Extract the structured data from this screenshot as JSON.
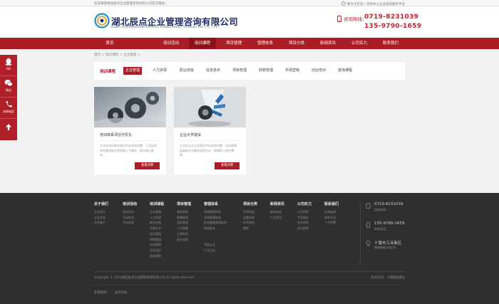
{
  "topbar": {
    "welcome": "欢迎来到湖北辰点企业管理咨询有限公司官方网站！",
    "slogan": "致力于打造一流的中小企业培训服务平台"
  },
  "header": {
    "logo_cn": "湖北辰点企业管理咨询有限公司",
    "logo_en": "HUBEI CHENDIAN ENTERPRISE MANAGEMENT CONSULTING CO., LTD",
    "hotline_label": "咨询热线：",
    "hotline_1": "0719-8231039",
    "hotline_2": "135-9790-1659"
  },
  "nav": {
    "items": [
      "首页",
      "培训活动",
      "培训课程",
      "项目管理",
      "管理体系",
      "项目分类",
      "新闻资讯",
      "公司实力",
      "联系我们"
    ],
    "active_index": 2
  },
  "breadcrumb": "首页 > 培训课程 > 企业管理 >",
  "float": {
    "items": [
      "QQ",
      "微信",
      "咨询电话"
    ]
  },
  "category": {
    "title": "培训课程",
    "items": [
      "企业管理",
      "人力资源",
      "职业技能",
      "信息技术",
      "项目管理",
      "财税管理",
      "市场营销",
      "创业培训",
      "其他课程"
    ],
    "active_index": 0
  },
  "cards": [
    {
      "title": "培训体系评估与优化",
      "desc": "企业在培训体系建设中存在的问题：公司培训体系建设缺乏规划和人才梯队，统计难以查询...",
      "button": "查看详情"
    },
    {
      "title": "企业大学建设",
      "desc": "企业在企业大学建设中存在的问题：培训管理层级缺乏必要的规划设计，前期投入相对薄弱...",
      "button": "查看详情"
    }
  ],
  "footer": {
    "columns": [
      {
        "head": "关于我们",
        "links": [
          "企业简介",
          "企业文化",
          "合作客户"
        ]
      },
      {
        "head": "培训活动",
        "links": [
          "培训活动",
          "活动报名",
          "活动回顾"
        ]
      },
      {
        "head": "培训课程",
        "links": [
          "企业管理",
          "人力资源",
          "职业技能",
          "信息技术",
          "项目管理",
          "财税管理",
          "市场营销",
          "创业培训",
          "其他课程"
        ]
      },
      {
        "head": "项目管理",
        "links": [
          "绩效管理",
          "薪酬管理",
          "组织管理",
          "人员管理",
          "工商财务",
          "职业规划"
        ]
      },
      {
        "head": "管理体系",
        "links": [
          "质量管理体系",
          "环境管理体系",
          "职业健康管理体系",
          "其他体系",
          "",
          "",
          "系统认证",
          "产品认证"
        ]
      },
      {
        "head": "项目分类",
        "links": [
          "专项资金",
          "品牌创建",
          "技术改造",
          "融资"
        ]
      },
      {
        "head": "新闻资讯",
        "links": [
          "新闻动态",
          "行业资讯"
        ]
      },
      {
        "head": "公司实力",
        "links": [
          "公司资质",
          "专家团队",
          "合作机构",
          "成功案例"
        ]
      },
      {
        "head": "联系我们",
        "links": [
          "在线咨询",
          "联系方式",
          "人才招聘"
        ]
      }
    ],
    "contacts": [
      {
        "value": "0719-8231039",
        "sub": "咨询热线"
      },
      {
        "value": "135-9790-1659",
        "sub": "联系电话"
      },
      {
        "value": "十堰市工业新区",
        "sub": "高端装备大道1号"
      }
    ],
    "copyright": "Copyright © 2018湖北辰点企业管理咨询有限公司 All rights reserved",
    "support": "技术支持：十堰网站建设",
    "links_label": "友情链接：",
    "links": [
      "辰点科技"
    ]
  }
}
